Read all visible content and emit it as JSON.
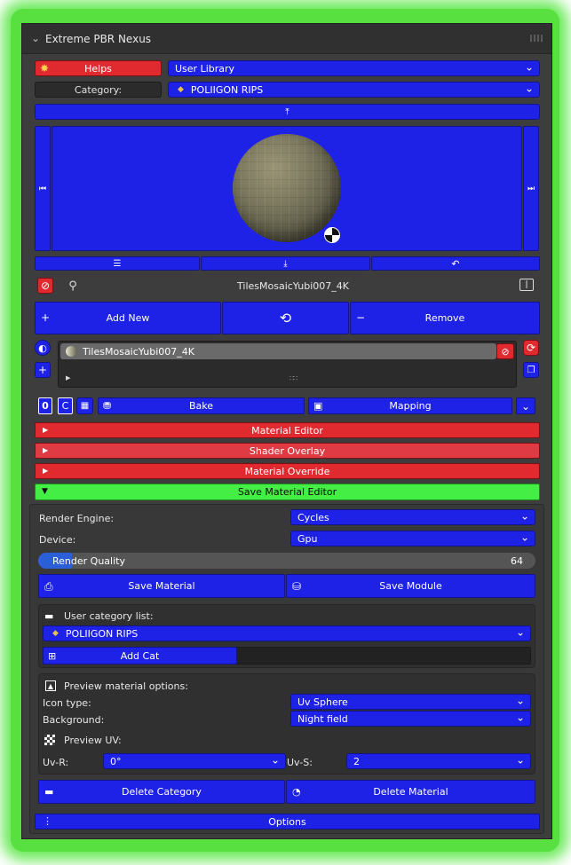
{
  "panel": {
    "title": "Extreme PBR Nexus"
  },
  "top": {
    "helps_label": "Helps",
    "library_value": "User Library",
    "category_label": "Category:",
    "category_value": "POLIIGON RIPS"
  },
  "material": {
    "name_bar": "TilesMosaicYubi007_4K",
    "list_item": "TilesMosaicYubi007_4K"
  },
  "actions": {
    "add_new": "Add New",
    "remove": "Remove"
  },
  "tools": {
    "zero_label": "0",
    "c_label": "C",
    "bake": "Bake",
    "mapping": "Mapping"
  },
  "sections": {
    "material_editor": "Material Editor",
    "shader_overlay": "Shader Overlay",
    "material_override": "Material Override",
    "save_material_editor": "Save Material Editor"
  },
  "save_editor": {
    "render_engine_label": "Render Engine:",
    "render_engine_value": "Cycles",
    "device_label": "Device:",
    "device_value": "Gpu",
    "render_quality_label": "Render Quality",
    "render_quality_value": "64",
    "save_material": "Save Material",
    "save_module": "Save Module",
    "user_category_label": "User category list:",
    "user_category_value": "POLIIGON RIPS",
    "add_cat": "Add Cat",
    "preview_options_label": "Preview material options:",
    "icon_type_label": "Icon type:",
    "icon_type_value": "Uv Sphere",
    "background_label": "Background:",
    "background_value": "Night field",
    "preview_uv_label": "Preview UV:",
    "uv_r_label": "Uv-R:",
    "uv_r_value": "0°",
    "uv_s_label": "Uv-S:",
    "uv_s_value": "2",
    "delete_category": "Delete Category",
    "delete_material": "Delete Material"
  },
  "footer": {
    "options": "Options"
  },
  "colors": {
    "accent_blue": "#1e22e6",
    "alert_red": "#e02a30",
    "active_green": "#44ee44",
    "panel_bg": "#3d3d3d"
  },
  "icons": [
    "chevron-down-icon",
    "flame-icon",
    "diamond-icon",
    "collapse-up-icon",
    "skip-back-icon",
    "skip-forward-icon",
    "sliders-icon",
    "download-icon",
    "undo-icon",
    "no-entry-icon",
    "search-icon",
    "info-icon",
    "plus-icon",
    "minus-icon",
    "refresh-icon",
    "sphere-icon",
    "folder-icon",
    "image-icon",
    "checker-icon",
    "trash-folder-icon"
  ]
}
